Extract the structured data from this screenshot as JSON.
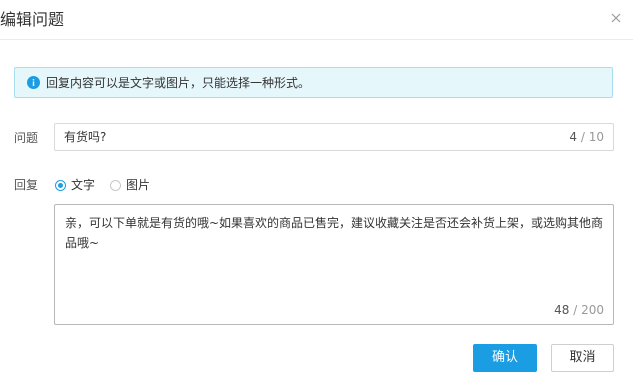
{
  "dialog": {
    "title": "编辑问题"
  },
  "notice": {
    "text": "回复内容可以是文字或图片，只能选择一种形式。",
    "color": "#1b9de4"
  },
  "question": {
    "label": "问题",
    "value": "有货吗?",
    "count_current": "4",
    "count_sep": " / ",
    "count_max": "10"
  },
  "reply": {
    "label": "回复",
    "options": [
      {
        "label": "文字",
        "selected": true
      },
      {
        "label": "图片",
        "selected": false
      }
    ],
    "value": "亲，可以下单就是有货的哦~如果喜欢的商品已售完，建议收藏关注是否还会补货上架，或选购其他商品哦~",
    "count_current": "48",
    "count_sep": " / ",
    "count_max": "200"
  },
  "actions": {
    "confirm_label": "确认",
    "cancel_label": "取消",
    "accent": "#1b9de4"
  }
}
